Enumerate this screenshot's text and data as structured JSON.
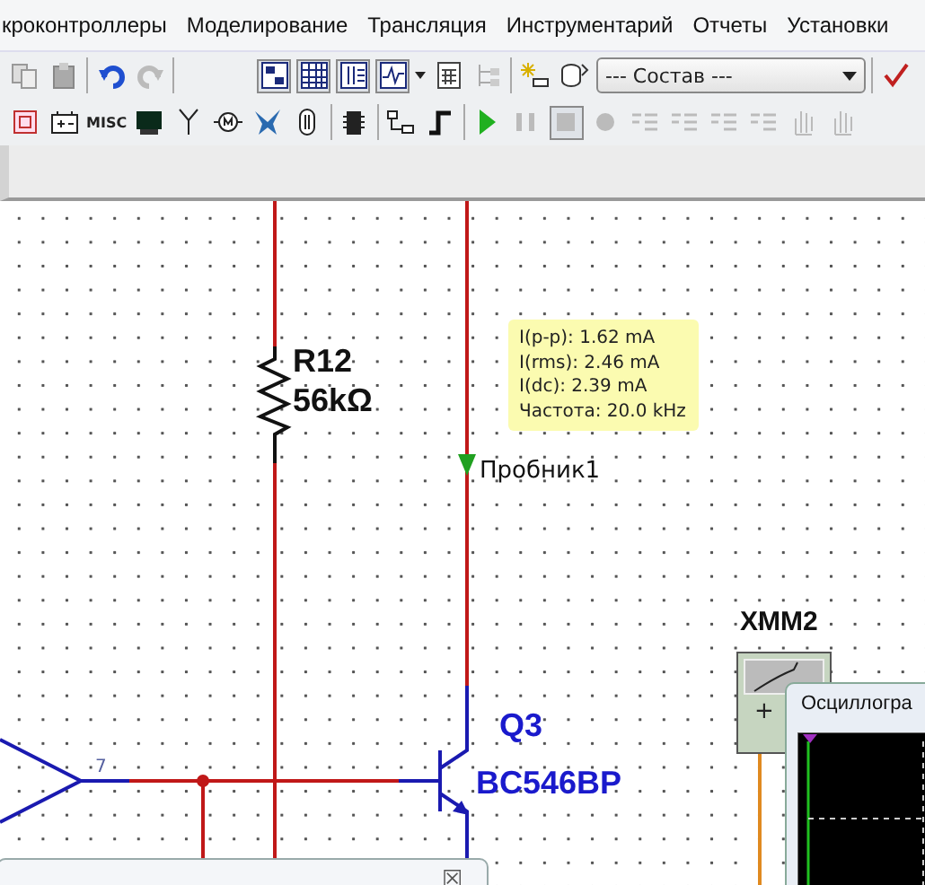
{
  "menu": [
    {
      "label": "кроконтроллеры"
    },
    {
      "label": "Моделирование"
    },
    {
      "label": "Трансляция"
    },
    {
      "label": "Инструментарий"
    },
    {
      "label": "Отчеты"
    },
    {
      "label": "Установки"
    }
  ],
  "toolbar_1": [
    {
      "kind": "copy"
    },
    {
      "kind": "paste"
    },
    {
      "kind": "sep"
    },
    {
      "kind": "undo"
    },
    {
      "kind": "redo"
    },
    {
      "kind": "sep"
    },
    {
      "kind": "gap"
    },
    {
      "kind": "view",
      "pressed": true
    },
    {
      "kind": "grid",
      "pressed": true
    },
    {
      "kind": "columns",
      "pressed": true
    },
    {
      "kind": "scope",
      "pressed": true
    },
    {
      "kind": "caret"
    },
    {
      "kind": "calc"
    },
    {
      "kind": "export"
    },
    {
      "kind": "sep"
    },
    {
      "kind": "spark"
    },
    {
      "kind": "db"
    }
  ],
  "component_select": {
    "value": "--- Состав ---"
  },
  "toolbar_2": [
    {
      "kind": "chip-red"
    },
    {
      "kind": "battery"
    },
    {
      "kind": "misc",
      "label": "MISC"
    },
    {
      "kind": "monitor"
    },
    {
      "kind": "antenna"
    },
    {
      "kind": "motor"
    },
    {
      "kind": "bird"
    },
    {
      "kind": "capsule"
    },
    {
      "kind": "sep"
    },
    {
      "kind": "ic"
    },
    {
      "kind": "sep"
    },
    {
      "kind": "node"
    },
    {
      "kind": "step"
    },
    {
      "kind": "sep"
    },
    {
      "kind": "play"
    },
    {
      "kind": "pause"
    },
    {
      "kind": "stop",
      "pressed": true
    },
    {
      "kind": "record"
    },
    {
      "kind": "list"
    },
    {
      "kind": "list"
    },
    {
      "kind": "list"
    },
    {
      "kind": "list"
    },
    {
      "kind": "hand"
    },
    {
      "kind": "hand"
    }
  ],
  "schematic": {
    "resistor": {
      "name": "R12",
      "value": "56kΩ"
    },
    "probe": {
      "name": "Пробник1",
      "readings": [
        "I(p-p): 1.62 mA",
        "I(rms): 2.46 mA",
        "I(dc): 2.39 mA",
        "Частота: 20.0 kHz"
      ]
    },
    "transistor": {
      "name": "Q3",
      "model": "BC546BP"
    },
    "pin_label": "7",
    "multimeter": {
      "name": "XMM2",
      "terminal": "+"
    }
  },
  "oscilloscope_window": {
    "title": "Осциллогра"
  },
  "dialog": {
    "close": "☒"
  }
}
